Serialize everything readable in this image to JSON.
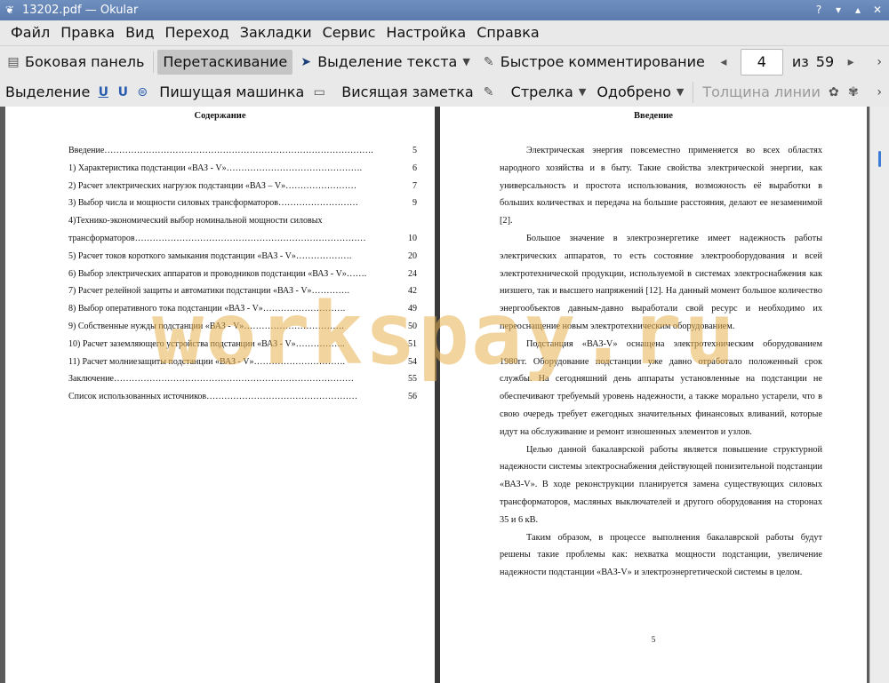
{
  "window": {
    "title": "13202.pdf — Okular"
  },
  "menubar": {
    "items": [
      "Файл",
      "Правка",
      "Вид",
      "Переход",
      "Закладки",
      "Сервис",
      "Настройка",
      "Справка"
    ]
  },
  "toolbar1": {
    "sidebar_label": "Боковая панель",
    "drag_label": "Перетаскивание",
    "text_select_label": "Выделение текста",
    "quick_comment_label": "Быстрое комментирование",
    "page_current": "4",
    "page_of_label": "из",
    "page_total": "59"
  },
  "toolbar2": {
    "highlight_label": "Выделение",
    "typewriter_label": "Пишущая машинка",
    "note_label": "Висящая заметка",
    "arrow_label": "Стрелка",
    "stamp_label": "Одобрено",
    "line_width_label": "Толщина линии"
  },
  "left_page": {
    "heading": "Содержание",
    "toc": [
      {
        "text": "Введение……………………………………………………………………………….",
        "page": "5"
      },
      {
        "text": "1) Характеристика подстанции «ВАЗ - V»……………………………………….",
        "page": "6"
      },
      {
        "text": "2) Расчет электрических нагрузок подстанции «ВАЗ – V»……………………",
        "page": "7"
      },
      {
        "text": "3) Выбор числа и мощности силовых трансформаторов………………………",
        "page": "9"
      },
      {
        "text": "4)Технико-экономический выбор номинальной мощности силовых",
        "page": ""
      },
      {
        "text": "трансформаторов……………………………………………………………………",
        "page": "10"
      },
      {
        "text": "5) Расчет токов короткого замыкания подстанции «ВАЗ - V»……………….",
        "page": "20"
      },
      {
        "text": "6) Выбор электрических аппаратов и проводников подстанции «ВАЗ - V»…….",
        "page": "24"
      },
      {
        "text": "7) Расчет релейной защиты и автоматики подстанции «ВАЗ - V»………….",
        "page": "42"
      },
      {
        "text": "8) Выбор оперативного тока подстанции «ВАЗ - V»……………………….",
        "page": "49"
      },
      {
        "text": "9) Собственные нужды подстанции «ВАЗ - V»…………………………….",
        "page": "50"
      },
      {
        "text": "10) Расчет заземляющего устройства подстанции «ВАЗ - V»……………..",
        "page": "51"
      },
      {
        "text": "11) Расчет молниезащиты подстанции «ВАЗ - V»………………………….",
        "page": "54"
      },
      {
        "text": "Заключение………………………………………………………………………",
        "page": "55"
      },
      {
        "text": "Список использованных источников……………………………………………",
        "page": "56"
      }
    ]
  },
  "right_page": {
    "heading": "Введение",
    "paragraphs": [
      "Электрическая энергия повсеместно применяется во всех областях народного хозяйства и в быту. Такие свойства электрической энергии, как универсальность и простота использования, возможность её выработки в больших количествах и передача на большие расстояния, делают ее незаменимой [2].",
      "Большое значение в электроэнергетике имеет надежность работы электрических аппаратов, то есть состояние электрооборудования и всей электротехнической продукции, используемой в системах электроснабжения как низшего, так и высшего напряжений [12]. На данный момент большое количество энергообъектов давным-давно выработали свой ресурс и необходимо их переоснащение новым электротехническим оборудованием.",
      "Подстанция «ВАЗ-V» оснащена электротехническим оборудованием 1980гг. Оборудование подстанции уже давно отработало положенный срок службы. На сегодняшний день аппараты установленные на подстанции не обеспечивают требуемый уровень надежности, а также морально устарели, что в свою очередь требует ежегодных значительных финансовых вливаний, которые идут на обслуживание и ремонт изношенных элементов и узлов.",
      "Целью данной бакалаврской работы является повышение структурной надежности системы электроснабжения действующей понизительной подстанции «ВАЗ-V». В ходе реконструкции планируется замена существующих силовых трансформаторов, масляных выключателей и другого оборудования на сторонах 35 и 6 кВ.",
      "Таким образом, в процессе выполнения бакалаврской работы будут решены такие проблемы как: нехватка мощности подстанции, увеличение надежности подстанции «ВАЗ-V» и электроэнергетической системы в целом."
    ],
    "page_number": "5"
  },
  "watermark": "workspay.ru"
}
